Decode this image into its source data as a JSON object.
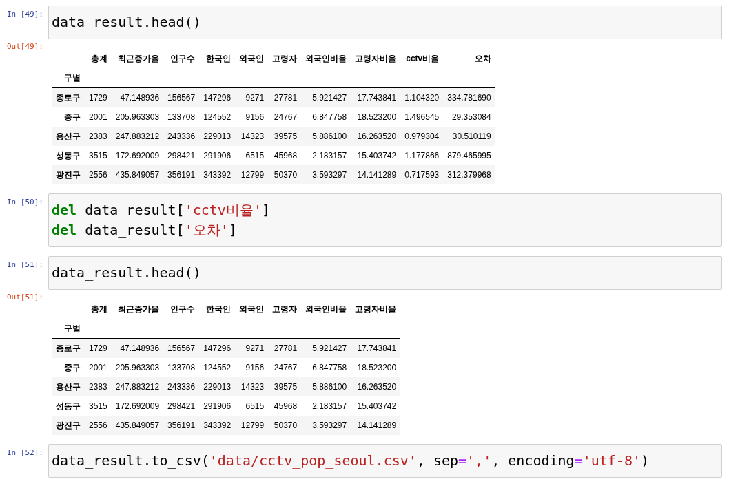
{
  "cells": [
    {
      "prompt": "In [49]:",
      "code": [
        [
          {
            "kind": "plain",
            "text": "data_result.head()"
          }
        ]
      ],
      "output": {
        "prompt": "Out[49]:",
        "index_name": "구별",
        "columns": [
          "총계",
          "최근증가율",
          "인구수",
          "한국인",
          "외국인",
          "고령자",
          "외국인비율",
          "고령자비율",
          "cctv비율",
          "오차"
        ],
        "rows": [
          {
            "index": "종로구",
            "cells": [
              "1729",
              "47.148936",
              "156567",
              "147296",
              "9271",
              "27781",
              "5.921427",
              "17.743841",
              "1.104320",
              "334.781690"
            ]
          },
          {
            "index": "중구",
            "cells": [
              "2001",
              "205.963303",
              "133708",
              "124552",
              "9156",
              "24767",
              "6.847758",
              "18.523200",
              "1.496545",
              "29.353084"
            ]
          },
          {
            "index": "용산구",
            "cells": [
              "2383",
              "247.883212",
              "243336",
              "229013",
              "14323",
              "39575",
              "5.886100",
              "16.263520",
              "0.979304",
              "30.510119"
            ]
          },
          {
            "index": "성동구",
            "cells": [
              "3515",
              "172.692009",
              "298421",
              "291906",
              "6515",
              "45968",
              "2.183157",
              "15.403742",
              "1.177866",
              "879.465995"
            ]
          },
          {
            "index": "광진구",
            "cells": [
              "2556",
              "435.849057",
              "356191",
              "343392",
              "12799",
              "50370",
              "3.593297",
              "14.141289",
              "0.717593",
              "312.379968"
            ]
          }
        ]
      }
    },
    {
      "prompt": "In [50]:",
      "code": [
        [
          {
            "kind": "keyword",
            "text": "del"
          },
          {
            "kind": "plain",
            "text": " data_result["
          },
          {
            "kind": "string",
            "text": "'cctv비율'"
          },
          {
            "kind": "plain",
            "text": "]"
          }
        ],
        [
          {
            "kind": "keyword",
            "text": "del"
          },
          {
            "kind": "plain",
            "text": " data_result["
          },
          {
            "kind": "string",
            "text": "'오차'"
          },
          {
            "kind": "plain",
            "text": "]"
          }
        ]
      ]
    },
    {
      "prompt": "In [51]:",
      "code": [
        [
          {
            "kind": "plain",
            "text": "data_result.head()"
          }
        ]
      ],
      "output": {
        "prompt": "Out[51]:",
        "index_name": "구별",
        "columns": [
          "총계",
          "최근증가율",
          "인구수",
          "한국인",
          "외국인",
          "고령자",
          "외국인비율",
          "고령자비율"
        ],
        "rows": [
          {
            "index": "종로구",
            "cells": [
              "1729",
              "47.148936",
              "156567",
              "147296",
              "9271",
              "27781",
              "5.921427",
              "17.743841"
            ]
          },
          {
            "index": "중구",
            "cells": [
              "2001",
              "205.963303",
              "133708",
              "124552",
              "9156",
              "24767",
              "6.847758",
              "18.523200"
            ]
          },
          {
            "index": "용산구",
            "cells": [
              "2383",
              "247.883212",
              "243336",
              "229013",
              "14323",
              "39575",
              "5.886100",
              "16.263520"
            ]
          },
          {
            "index": "성동구",
            "cells": [
              "3515",
              "172.692009",
              "298421",
              "291906",
              "6515",
              "45968",
              "2.183157",
              "15.403742"
            ]
          },
          {
            "index": "광진구",
            "cells": [
              "2556",
              "435.849057",
              "356191",
              "343392",
              "12799",
              "50370",
              "3.593297",
              "14.141289"
            ]
          }
        ]
      }
    },
    {
      "prompt": "In [52]:",
      "code": [
        [
          {
            "kind": "plain",
            "text": "data_result.to_csv("
          },
          {
            "kind": "string",
            "text": "'data/cctv_pop_seoul.csv'"
          },
          {
            "kind": "plain",
            "text": ", sep"
          },
          {
            "kind": "operator",
            "text": "="
          },
          {
            "kind": "string",
            "text": "','"
          },
          {
            "kind": "plain",
            "text": ", encoding"
          },
          {
            "kind": "operator",
            "text": "="
          },
          {
            "kind": "string",
            "text": "'utf-8'"
          },
          {
            "kind": "plain",
            "text": ")"
          }
        ]
      ]
    }
  ]
}
